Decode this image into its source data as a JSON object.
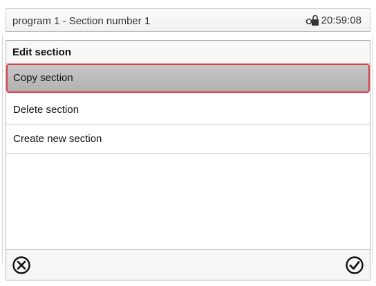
{
  "header": {
    "title": "program 1 - Section number 1",
    "time": "20:59:08",
    "lock_icon": "lock-icon"
  },
  "panel": {
    "heading": "Edit section",
    "items": [
      {
        "label": "Copy section",
        "selected": true
      },
      {
        "label": "Delete section",
        "selected": false
      },
      {
        "label": "Create new section",
        "selected": false
      }
    ]
  },
  "footer": {
    "cancel_icon": "cancel-icon",
    "confirm_icon": "confirm-icon"
  },
  "colors": {
    "selection_border": "#d9414b",
    "selection_fill": "#bcbcbc"
  }
}
